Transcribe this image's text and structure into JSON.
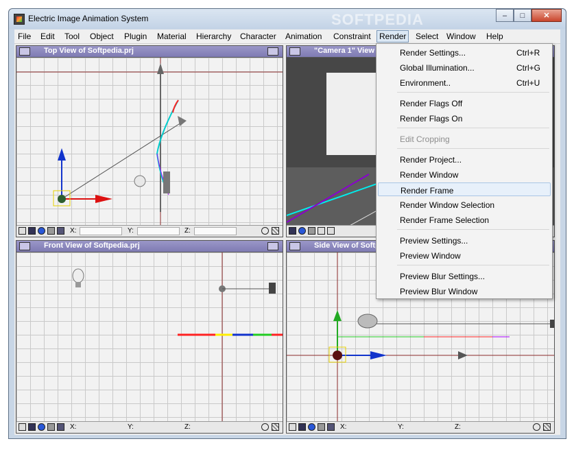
{
  "window": {
    "title": "Electric Image Animation System",
    "watermark": "SOFTPEDIA"
  },
  "menubar": [
    "File",
    "Edit",
    "Tool",
    "Object",
    "Plugin",
    "Material",
    "Hierarchy",
    "Character",
    "Animation",
    "Constraint",
    "Render",
    "Select",
    "Window",
    "Help"
  ],
  "viewports": {
    "top": {
      "title": "Top View of Softpedia.prj",
      "x": "X:",
      "y": "Y:",
      "z": "Z:"
    },
    "camera": {
      "title": "\"Camera 1\" View"
    },
    "front": {
      "title": "Front View of Softpedia.prj",
      "x": "X:",
      "y": "Y:",
      "z": "Z:"
    },
    "side": {
      "title": "Side View of Softpedia.prj",
      "x": "X:",
      "y": "Y:",
      "z": "Z:"
    }
  },
  "render_menu": {
    "items": [
      {
        "label": "Render Settings...",
        "shortcut": "Ctrl+R"
      },
      {
        "label": "Global Illumination...",
        "shortcut": "Ctrl+G"
      },
      {
        "label": "Environment..",
        "shortcut": "Ctrl+U"
      },
      {
        "label": "Render Flags Off",
        "shortcut": ""
      },
      {
        "label": "Render Flags On",
        "shortcut": ""
      },
      {
        "label": "Edit Cropping",
        "shortcut": ""
      },
      {
        "label": "Render Project...",
        "shortcut": ""
      },
      {
        "label": "Render Window",
        "shortcut": ""
      },
      {
        "label": "Render Frame",
        "shortcut": ""
      },
      {
        "label": "Render Window Selection",
        "shortcut": ""
      },
      {
        "label": "Render Frame Selection",
        "shortcut": ""
      },
      {
        "label": "Preview Settings...",
        "shortcut": ""
      },
      {
        "label": "Preview Window",
        "shortcut": ""
      },
      {
        "label": "Preview Blur Settings...",
        "shortcut": ""
      },
      {
        "label": "Preview Blur Window",
        "shortcut": ""
      }
    ]
  }
}
